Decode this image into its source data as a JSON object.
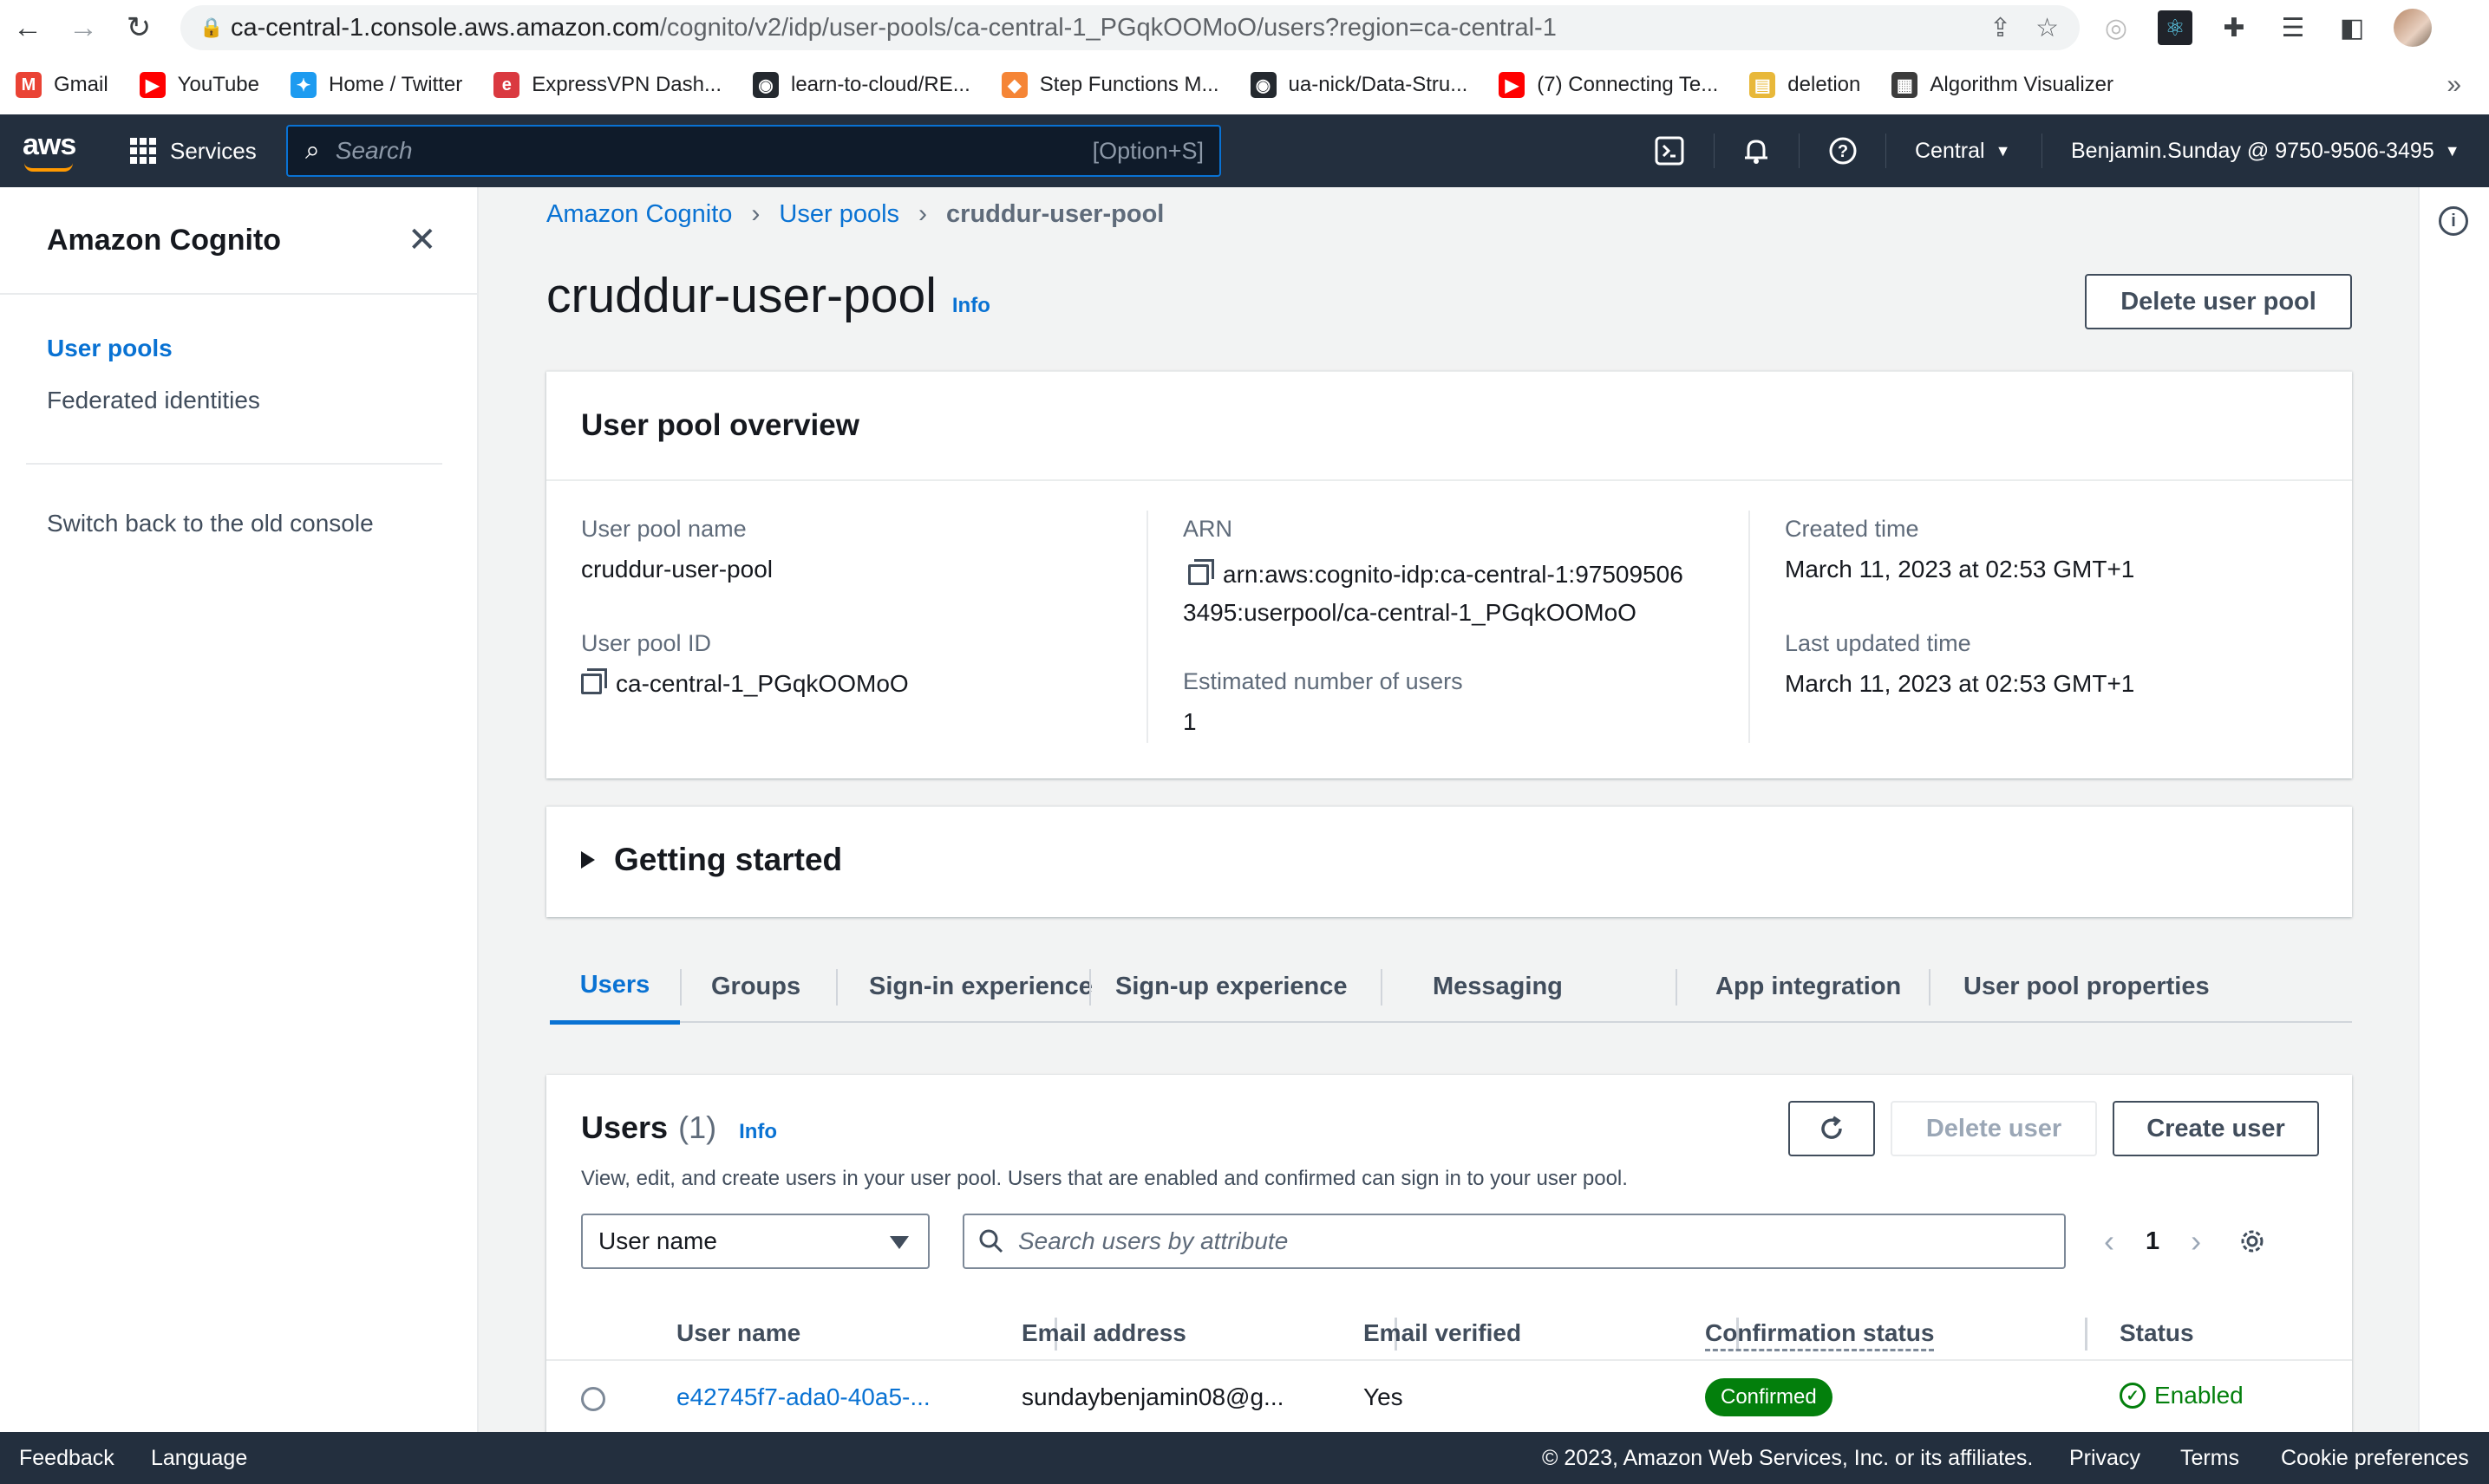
{
  "browser": {
    "url_host": "ca-central-1.console.aws.amazon.com",
    "url_path": "/cognito/v2/idp/user-pools/ca-central-1_PGqkOOMoO/users?region=ca-central-1",
    "bookmarks": [
      {
        "label": "Gmail",
        "icon": "gmail-icon",
        "color": "#ea4335"
      },
      {
        "label": "YouTube",
        "icon": "youtube-icon",
        "color": "#ff0000"
      },
      {
        "label": "Home / Twitter",
        "icon": "twitter-icon",
        "color": "#1d9bf0"
      },
      {
        "label": "ExpressVPN Dash...",
        "icon": "expressvpn-icon",
        "color": "#da3940"
      },
      {
        "label": "learn-to-cloud/RE...",
        "icon": "github-icon",
        "color": "#24292f"
      },
      {
        "label": "Step Functions M...",
        "icon": "aws-cube-icon",
        "color": "#f58536"
      },
      {
        "label": "ua-nick/Data-Stru...",
        "icon": "github-icon",
        "color": "#24292f"
      },
      {
        "label": "(7) Connecting Te...",
        "icon": "youtube-icon",
        "color": "#ff0000"
      },
      {
        "label": "deletion",
        "icon": "folder-icon",
        "color": "#e8b83a"
      },
      {
        "label": "Algorithm Visualizer",
        "icon": "algorithm-visualizer-icon",
        "color": "#3c3c3c"
      }
    ],
    "bookmarks_more": "»"
  },
  "awsnav": {
    "logo": "aws",
    "services_label": "Services",
    "search_placeholder": "Search",
    "search_shortcut": "[Option+S]",
    "region": "Central",
    "account": "Benjamin.Sunday @ 9750-9506-3495"
  },
  "sidebar": {
    "title": "Amazon Cognito",
    "items": [
      {
        "label": "User pools"
      },
      {
        "label": "Federated identities"
      }
    ],
    "switch_label": "Switch back to the old console"
  },
  "breadcrumb": [
    "Amazon Cognito",
    "User pools",
    "cruddur-user-pool"
  ],
  "page": {
    "title": "cruddur-user-pool",
    "info": "Info",
    "delete_pool_label": "Delete user pool"
  },
  "overview": {
    "header": "User pool overview",
    "pool_name_label": "User pool name",
    "pool_name": "cruddur-user-pool",
    "pool_id_label": "User pool ID",
    "pool_id": "ca-central-1_PGqkOOMoO",
    "arn_label": "ARN",
    "arn_line1": "arn:aws:cognito-idp:ca-central-1:97509506",
    "arn_line2": "3495:userpool/ca-central-1_PGqkOOMoO",
    "est_users_label": "Estimated number of users",
    "est_users": "1",
    "created_label": "Created time",
    "created": "March 11, 2023 at 02:53 GMT+1",
    "updated_label": "Last updated time",
    "updated": "March 11, 2023 at 02:53 GMT+1"
  },
  "getting_started": "Getting started",
  "tabs": [
    "Users",
    "Groups",
    "Sign-in experience",
    "Sign-up experience",
    "Messaging",
    "App integration",
    "User pool properties"
  ],
  "users": {
    "title": "Users",
    "count": "(1)",
    "info": "Info",
    "description": "View, edit, and create users in your user pool. Users that are enabled and confirmed can sign in to your user pool.",
    "delete_label": "Delete user",
    "create_label": "Create user",
    "filter_selected": "User name",
    "search_placeholder": "Search users by attribute",
    "page": "1",
    "columns": [
      "User name",
      "Email address",
      "Email verified",
      "Confirmation status",
      "Status"
    ],
    "rows": [
      {
        "username": "e42745f7-ada0-40a5-...",
        "email": "sundaybenjamin08@g...",
        "verified": "Yes",
        "confirmation": "Confirmed",
        "status": "Enabled"
      }
    ]
  },
  "footer": {
    "feedback": "Feedback",
    "language": "Language",
    "copyright": "© 2023, Amazon Web Services, Inc. or its affiliates.",
    "privacy": "Privacy",
    "terms": "Terms",
    "cookies": "Cookie preferences"
  },
  "colors": {
    "aws_nav": "#232f3e",
    "link": "#0972d3",
    "success": "#037f0c",
    "accent": "#ff9900"
  }
}
